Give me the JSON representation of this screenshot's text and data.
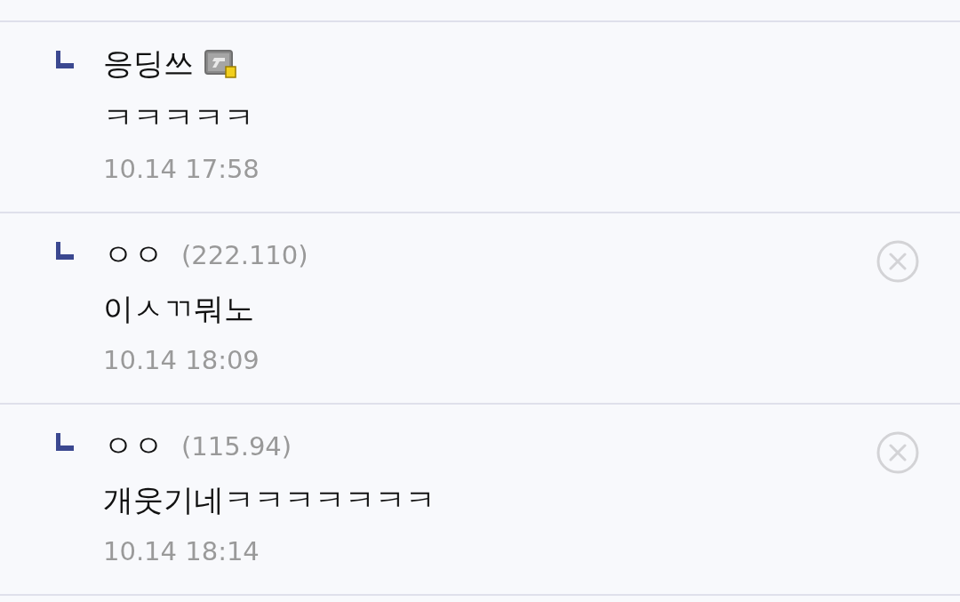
{
  "comments": [
    {
      "author": "응딩쓰",
      "fixed_nick": true,
      "deletable": false,
      "text": "ㅋㅋㅋㅋㅋ",
      "date": "10.14 17:58"
    },
    {
      "author": "ㅇㅇ",
      "ip": "(222.110)",
      "fixed_nick": false,
      "deletable": true,
      "text": "이ㅅㄲ뭐노",
      "date": "10.14 18:09"
    },
    {
      "author": "ㅇㅇ",
      "ip": "(115.94)",
      "fixed_nick": false,
      "deletable": true,
      "text": "개웃기네ㅋㅋㅋㅋㅋㅋㅋ",
      "date": "10.14 18:14"
    }
  ]
}
